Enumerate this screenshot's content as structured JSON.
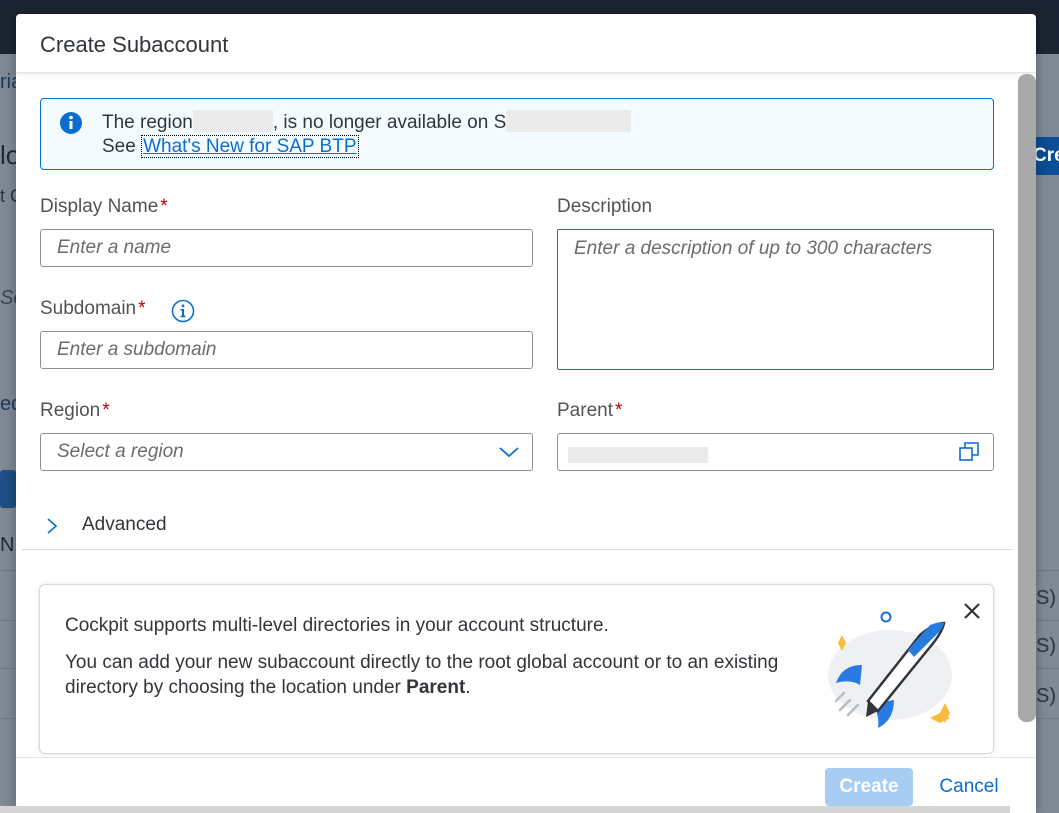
{
  "dialog": {
    "title": "Create Subaccount"
  },
  "info": {
    "line1_prefix": "The region",
    "line1_mid": ", is no longer available on S",
    "line2_prefix": "See ",
    "link_text": "What's New for SAP BTP"
  },
  "form": {
    "display_name": {
      "label": "Display Name",
      "required": "*",
      "placeholder": "Enter a name"
    },
    "description": {
      "label": "Description",
      "placeholder": "Enter a description of up to 300 characters"
    },
    "subdomain": {
      "label": "Subdomain",
      "required": "*",
      "placeholder": "Enter a subdomain"
    },
    "region": {
      "label": "Region",
      "required": "*",
      "placeholder": "Select a region"
    },
    "parent": {
      "label": "Parent",
      "required": "*"
    },
    "advanced": {
      "label": "Advanced"
    }
  },
  "card": {
    "text1": "Cockpit supports multi-level directories in your account structure.",
    "text2_prefix": "You can add your new subaccount directly to the root global account or to an existing directory by choosing the location under ",
    "text2_bold": "Parent",
    "text2_suffix": "."
  },
  "footer": {
    "create_label": "Create",
    "cancel_label": "Cancel"
  },
  "background": {
    "frag1": "ria",
    "frag2": "lo",
    "frag3": "t C",
    "frag4": "Se",
    "frag5": "ed",
    "frag6": "N",
    "right_btn": "Cre",
    "right_s1": "S)",
    "right_s2": "S)",
    "right_s3": "S)"
  },
  "colors": {
    "accent": "#0a6ed1",
    "required": "#bb0000",
    "create_disabled": "#a7cdf2"
  }
}
